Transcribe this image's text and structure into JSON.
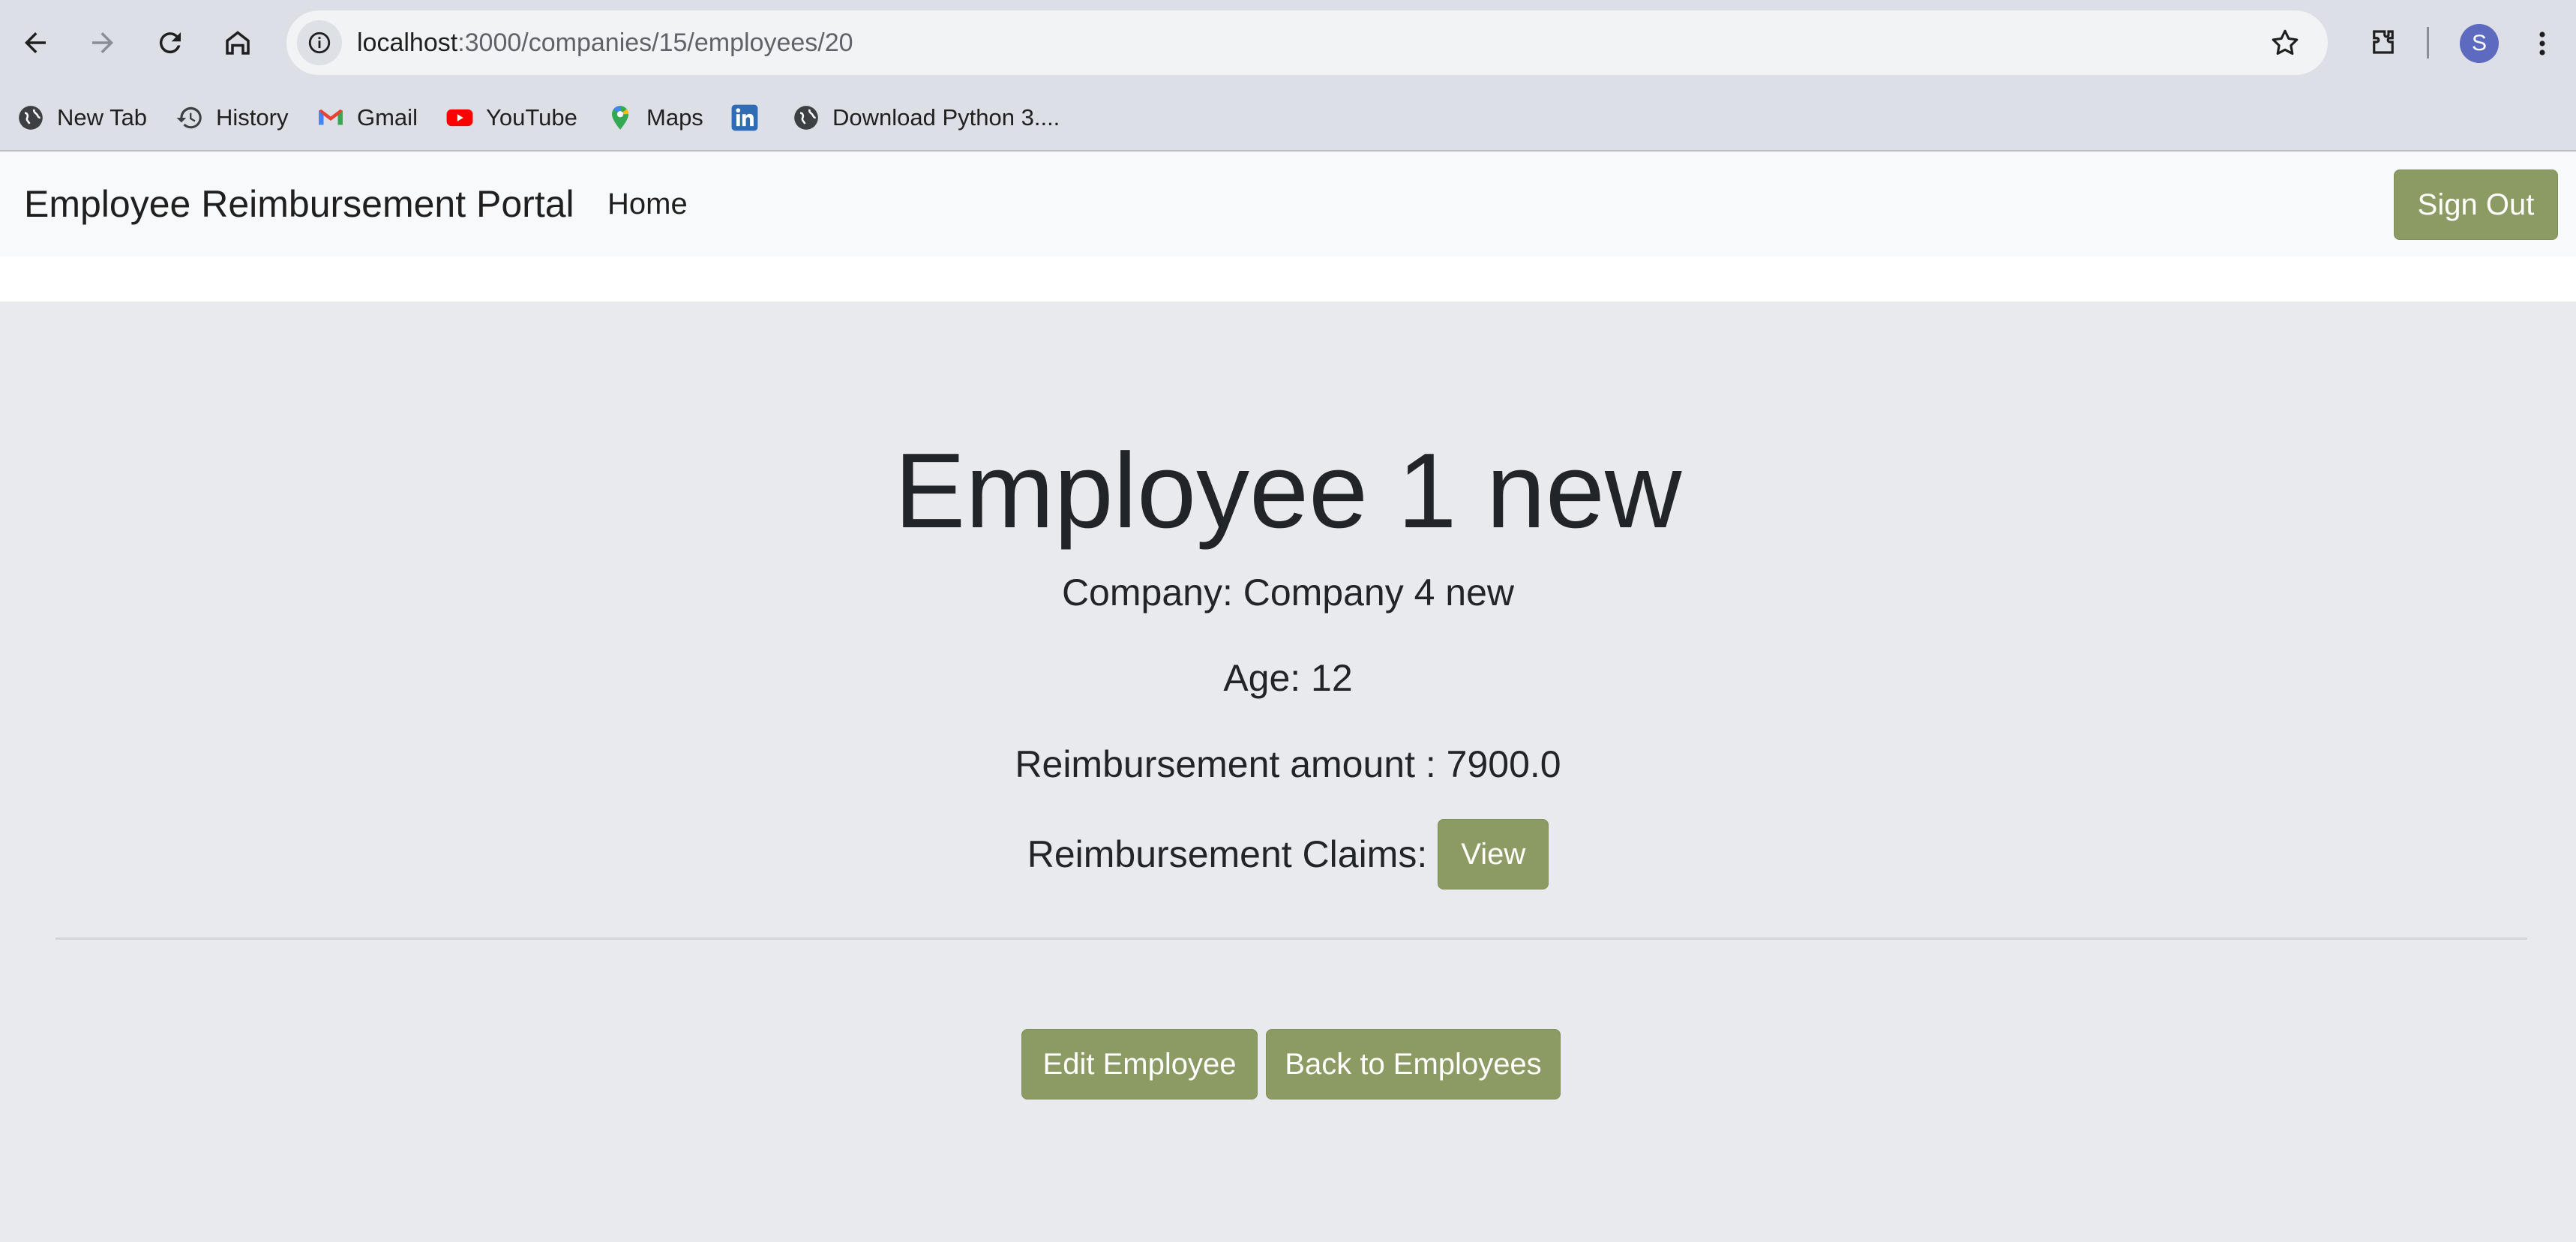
{
  "browser": {
    "url_host": "localhost",
    "url_rest": ":3000/companies/15/employees/20",
    "profile_initial": "S",
    "bookmarks": [
      {
        "label": "New Tab",
        "icon": "globe-icon"
      },
      {
        "label": "History",
        "icon": "history-icon"
      },
      {
        "label": "Gmail",
        "icon": "gmail-icon"
      },
      {
        "label": "YouTube",
        "icon": "youtube-icon"
      },
      {
        "label": "Maps",
        "icon": "maps-icon"
      },
      {
        "label": "",
        "icon": "linkedin-icon"
      },
      {
        "label": "Download Python 3....",
        "icon": "globe-icon"
      }
    ]
  },
  "navbar": {
    "brand": "Employee Reimbursement Portal",
    "home": "Home",
    "sign_out": "Sign Out"
  },
  "employee": {
    "name": "Employee 1 new",
    "company_line": "Company: Company 4 new",
    "age_line": "Age: 12",
    "reimbursement_line": "Reimbursement amount : 7900.0",
    "claims_label": "Reimbursement Claims:",
    "view_button": "View"
  },
  "actions": {
    "edit": "Edit Employee",
    "back": "Back to Employees"
  },
  "colors": {
    "accent": "#8c9a63",
    "page_background": "#e9eaee",
    "navbar_background": "#f8f9fa"
  }
}
